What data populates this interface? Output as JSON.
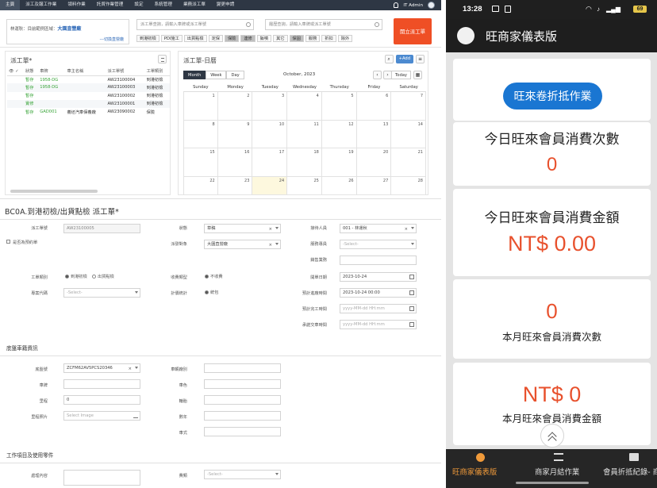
{
  "topnav": {
    "items": [
      "主頁",
      "派工及報工作業",
      "領料作業",
      "託貿作業管理",
      "設定",
      "系統管理",
      "業務派工單",
      "變更申請"
    ],
    "active_index": 0,
    "user": "IT Admin"
  },
  "filter": {
    "text_prefix": "林運秋：目前範例區域：",
    "text_highlight": "大園直營廠",
    "change_link": "---切換直營廠",
    "search1_placeholder": "派工單查詢，請輸入車牌或派工單號",
    "search2_placeholder": "履歷查詢，請輸入車牌或派工單號",
    "chips": [
      {
        "label": "到港初檢",
        "on": false
      },
      {
        "label": "PDI施工",
        "on": false
      },
      {
        "label": "出貨點檢",
        "on": false
      },
      {
        "label": "定保",
        "on": false
      },
      {
        "label": "保險",
        "on": true
      },
      {
        "label": "連修",
        "on": true
      },
      {
        "label": "鈑噴",
        "on": false
      },
      {
        "label": "其它",
        "on": false
      },
      {
        "label": "保固",
        "on": true
      },
      {
        "label": "服務",
        "on": false
      },
      {
        "label": "折扣",
        "on": false
      },
      {
        "label": "除外",
        "on": false
      }
    ],
    "create_button": "開立派工單"
  },
  "worklist": {
    "title": "派工單*",
    "headers": [
      "",
      "狀態",
      "車牌",
      "車主名稱",
      "派工單號",
      "工單類別"
    ],
    "rows": [
      {
        "status": "暫存",
        "status_color": "green",
        "plate": "1958-DG",
        "owner": "",
        "no": "AW23100004",
        "type": "到港初檢"
      },
      {
        "status": "暫存",
        "status_color": "green",
        "plate": "1958-DG",
        "owner": "",
        "no": "AW23100003",
        "type": "到港初檢"
      },
      {
        "status": "暫存",
        "status_color": "green",
        "plate": "",
        "owner": "",
        "no": "AW23100002",
        "type": "到港初檢"
      },
      {
        "status": "實修",
        "status_color": "green",
        "plate": "",
        "owner": "",
        "no": "AW23100001",
        "type": "到港初檢"
      },
      {
        "status": "暫存",
        "status_color": "green",
        "plate": "GAD001",
        "owner": "義坯汽車保養廠",
        "no": "AW23090002",
        "type": "保險"
      }
    ]
  },
  "calendar": {
    "title": "派工單-日曆",
    "add_label": "+Add",
    "views": [
      "Month",
      "Week",
      "Day"
    ],
    "active_view": 0,
    "month_label": "October, 2023",
    "today_label": "Today",
    "weekdays": [
      "Sunday",
      "Monday",
      "Tuesday",
      "Wednesday",
      "Thursday",
      "Friday",
      "Saturday"
    ],
    "weeks": [
      [
        "1",
        "2",
        "3",
        "4",
        "5",
        "6",
        "7"
      ],
      [
        "8",
        "9",
        "10",
        "11",
        "12",
        "13",
        "14"
      ],
      [
        "15",
        "16",
        "17",
        "18",
        "19",
        "20",
        "21"
      ],
      [
        "22",
        "23",
        "24",
        "25",
        "26",
        "27",
        "28"
      ]
    ],
    "today_day": "24"
  },
  "form": {
    "title": "BC0A.到港初檢/出貨點檢 派工單*",
    "fields": {
      "work_no_label": "派工單號",
      "work_no_value": "AW23100005",
      "reserve_label": "是否為預約單",
      "status_label": "狀態",
      "status_value": "草稿",
      "receiver_label": "接待人員",
      "receiver_value": "001 - 林運秋",
      "dispatch_label": "派發對象",
      "dispatch_value": "大園直營廠",
      "consultant_label": "服務專員",
      "consultant_value": "-Select-",
      "sales_label": "銷售業務",
      "worktype_label": "工單類別",
      "worktype_opt1": "到港初檢",
      "worktype_opt2": "出貨點檢",
      "charge_label": "收費類型",
      "charge_opt": "不收費",
      "open_date_label": "開單日期",
      "open_date_value": "2023-10-24",
      "project_label": "專案代碼",
      "project_value": "-Select-",
      "plan_label": "計價統計",
      "plan_opt": "統包",
      "expected_in_label": "預計進廠時間",
      "expected_in_value": "2023-10-24 00:00",
      "expected_done_label": "預計完工時間",
      "expected_done_value": "yyyy-MM-dd HH:mm",
      "delivery_label": "承諾交車時間",
      "delivery_value": "yyyy-MM-dd HH:mm"
    },
    "chassis_section": "底盤車籍資訊",
    "chassis": {
      "vin_label": "底盤號",
      "vin_value": "ZCFM62AV5PCS20346",
      "plate_label": "車牌",
      "mileage_label": "里程",
      "mileage_value": "0",
      "photo_label": "里程照片",
      "photo_value": "Select Image",
      "brand_label": "車輛廠別",
      "color_label": "車色",
      "tire_label": "輪胎",
      "year_label": "數年",
      "car_label": "車式"
    },
    "items_section": "工作項目及使用零件",
    "items": {
      "content_label": "處理內容",
      "category_label": "費類",
      "category_value": "-Select-"
    }
  },
  "phone": {
    "status_time": "13:28",
    "status_battery": "69",
    "app_title": "旺商家儀表版",
    "pill_button": "旺來卷折抵作業",
    "cards": [
      {
        "label": "今日旺來會員消費次數",
        "value": "0"
      },
      {
        "label": "今日旺來會員消費金額",
        "value": "NT$ 0.00"
      },
      {
        "label": "本月旺來會員消費次數",
        "value": "0"
      },
      {
        "label": "本月旺來會員消費金額",
        "value": "NT$ 0"
      }
    ],
    "bottom_nav": [
      "旺商家儀表版",
      "商家月結作業",
      "會員折抵紀錄- 商"
    ]
  }
}
